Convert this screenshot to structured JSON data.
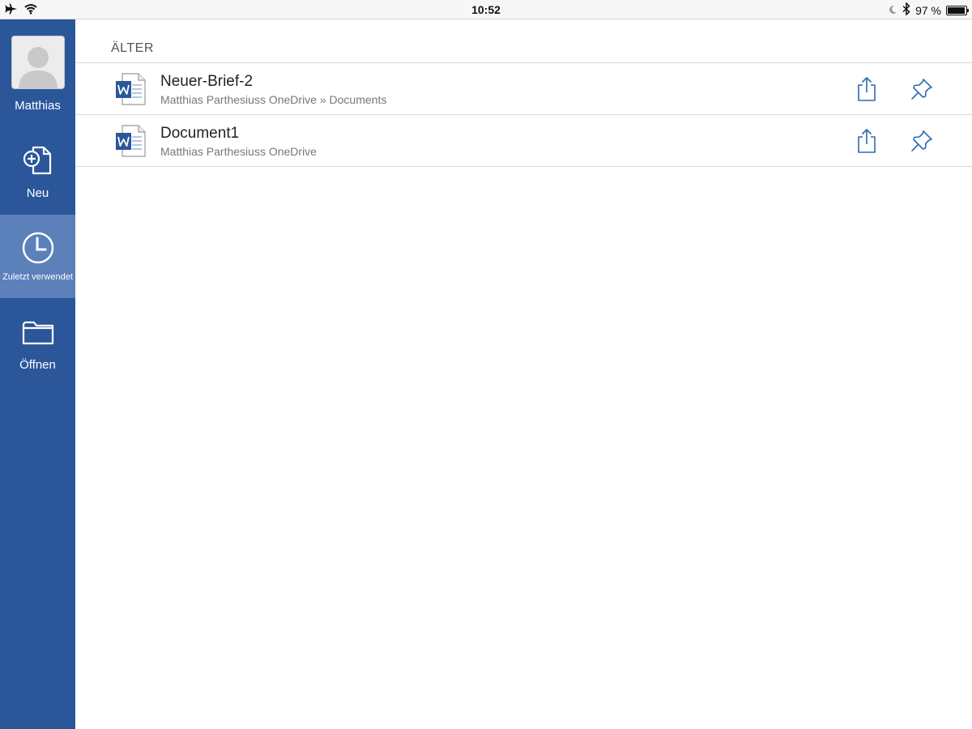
{
  "status_bar": {
    "time": "10:52",
    "battery_text": "97 %",
    "battery_level": 0.97,
    "icons": [
      "airplane-icon",
      "wifi-icon",
      "moon-icon",
      "bluetooth-icon",
      "battery-icon"
    ]
  },
  "sidebar": {
    "user": {
      "name": "Matthias"
    },
    "items": [
      {
        "label": "Neu",
        "icon": "new-document-icon",
        "active": false
      },
      {
        "label": "Zuletzt verwendet",
        "icon": "clock-icon",
        "active": true
      },
      {
        "label": "Öffnen",
        "icon": "folder-icon",
        "active": false
      }
    ]
  },
  "colors": {
    "sidebar_bg": "#2b579a",
    "sidebar_active": "#5b80ba",
    "action_icon": "#2b6cb0",
    "word_blue": "#2b579a"
  },
  "recent": {
    "section_title": "ÄLTER",
    "documents": [
      {
        "title": "Neuer-Brief-2",
        "path": "Matthias Parthesiuss OneDrive » Documents",
        "icon": "word-document-icon"
      },
      {
        "title": "Document1",
        "path": "Matthias Parthesiuss OneDrive",
        "icon": "word-document-icon"
      }
    ],
    "row_actions": [
      "share-icon",
      "pin-icon"
    ]
  }
}
